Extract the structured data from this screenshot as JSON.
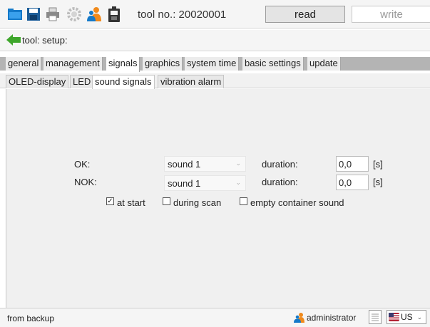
{
  "header": {
    "tool_no": "tool no.: 20020001",
    "read_label": "read",
    "write_label": "write"
  },
  "breadcrumb": {
    "text": "tool: setup:"
  },
  "tabs": [
    "general",
    "management",
    "signals",
    "graphics",
    "system time",
    "basic settings",
    "update"
  ],
  "subtabs": [
    "OLED-display",
    "LED",
    "sound signals",
    "vibration alarm"
  ],
  "signals": {
    "ok_label": "OK:",
    "ok_sound": "sound 1",
    "ok_duration_label": "duration:",
    "ok_duration_value": "0,0",
    "ok_unit": "[s]",
    "nok_label": "NOK:",
    "nok_sound": "sound 1",
    "nok_duration_label": "duration:",
    "nok_duration_value": "0,0",
    "nok_unit": "[s]",
    "at_start_label": "at start",
    "at_start_checked": true,
    "during_scan_label": "during scan",
    "during_scan_checked": false,
    "empty_container_label": "empty container sound",
    "empty_container_checked": false
  },
  "status": {
    "text": "from backup",
    "user": "administrator",
    "language": "US"
  }
}
